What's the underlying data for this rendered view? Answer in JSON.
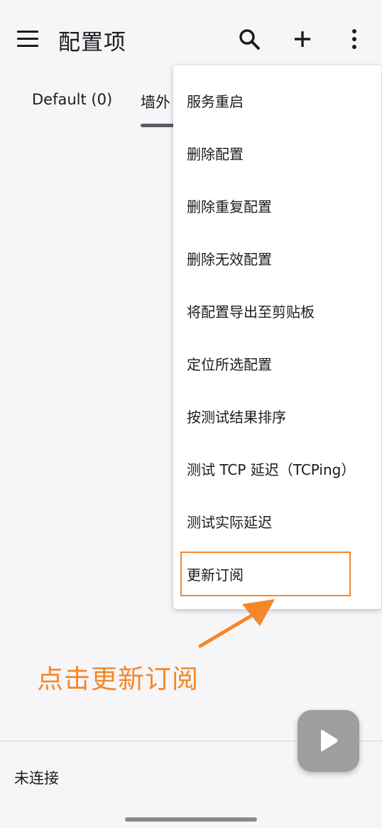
{
  "appbar": {
    "title": "配置项",
    "icons": [
      "menu-icon",
      "search-icon",
      "add-icon",
      "more-vert-icon"
    ]
  },
  "tabs": [
    {
      "label": "Default (0)"
    },
    {
      "label": "墙外"
    }
  ],
  "overflow_menu": {
    "items": [
      {
        "label": "服务重启"
      },
      {
        "label": "删除配置"
      },
      {
        "label": "删除重复配置"
      },
      {
        "label": "删除无效配置"
      },
      {
        "label": "将配置导出至剪贴板"
      },
      {
        "label": "定位所选配置"
      },
      {
        "label": "按测试结果排序"
      },
      {
        "label": "测试 TCP 延迟（TCPing）"
      },
      {
        "label": "测试实际延迟"
      },
      {
        "label": "更新订阅"
      }
    ],
    "highlighted_item": "更新订阅"
  },
  "annotation": {
    "text": "点击更新订阅",
    "color": "#f5872a"
  },
  "status": {
    "text": "未连接"
  },
  "fab": {
    "icon": "play-icon",
    "color": "#9e9e9e"
  }
}
